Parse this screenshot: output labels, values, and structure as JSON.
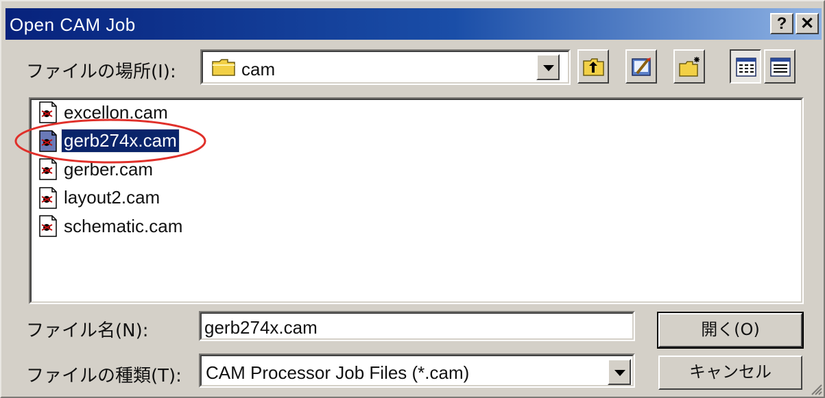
{
  "window": {
    "title": "Open CAM Job",
    "help_glyph": "?",
    "close_glyph": "✕"
  },
  "location": {
    "label": "ファイルの場所(I):",
    "value": "cam",
    "icon": "folder-icon"
  },
  "toolbar": {
    "buttons": [
      "up-one-level-icon",
      "desktop-icon",
      "new-folder-icon",
      "list-view-icon",
      "details-view-icon"
    ]
  },
  "files": [
    {
      "name": "excellon.cam",
      "selected": false
    },
    {
      "name": "gerb274x.cam",
      "selected": true
    },
    {
      "name": "gerber.cam",
      "selected": false
    },
    {
      "name": "layout2.cam",
      "selected": false
    },
    {
      "name": "schematic.cam",
      "selected": false
    }
  ],
  "filename": {
    "label": "ファイル名(N):",
    "value": "gerb274x.cam"
  },
  "filetype": {
    "label": "ファイルの種類(T):",
    "value": "CAM Processor Job Files (*.cam)"
  },
  "buttons": {
    "open": "開く(O)",
    "cancel": "キャンセル"
  },
  "colors": {
    "title_bar": "#07227c",
    "selection": "#0a246a",
    "annotation": "#e0302a",
    "dialog_face": "#d4d0c8"
  }
}
